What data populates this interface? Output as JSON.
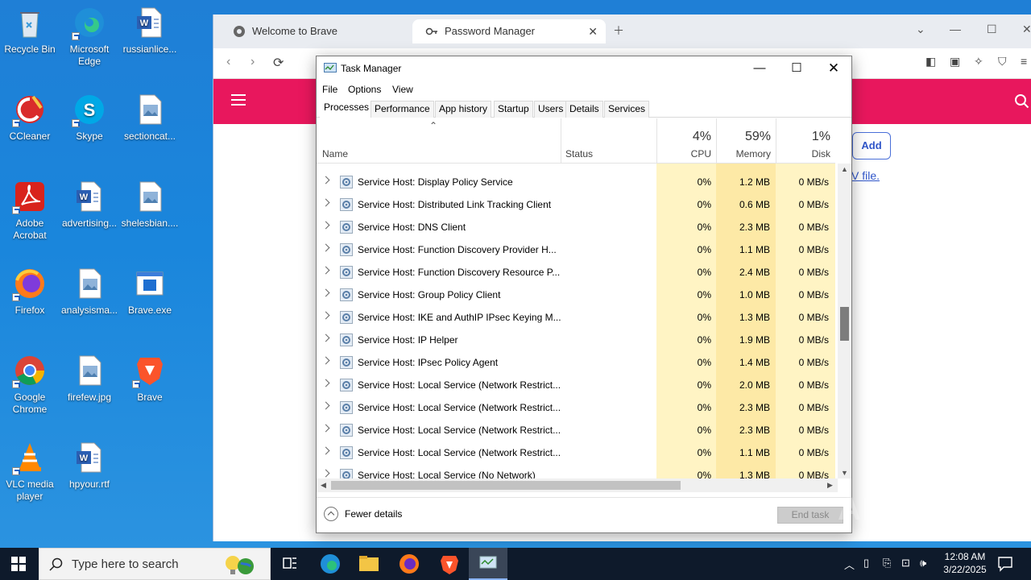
{
  "desktop": {
    "icons": [
      {
        "label": "Recycle Bin",
        "icon": "recycle-bin-icon"
      },
      {
        "label": "Microsoft Edge",
        "icon": "edge-icon"
      },
      {
        "label": "russianlice...",
        "icon": "word-doc-icon"
      },
      {
        "label": "CCleaner",
        "icon": "ccleaner-icon"
      },
      {
        "label": "Skype",
        "icon": "skype-icon"
      },
      {
        "label": "sectioncat...",
        "icon": "image-file-icon"
      },
      {
        "label": "Adobe Acrobat",
        "icon": "acrobat-icon"
      },
      {
        "label": "advertising...",
        "icon": "word-doc-icon"
      },
      {
        "label": "shelesbian....",
        "icon": "image-file-icon"
      },
      {
        "label": "Firefox",
        "icon": "firefox-icon"
      },
      {
        "label": "analysisma...",
        "icon": "image-file-icon"
      },
      {
        "label": "Brave.exe",
        "icon": "exe-file-icon"
      },
      {
        "label": "Google Chrome",
        "icon": "chrome-icon"
      },
      {
        "label": "firefew.jpg",
        "icon": "image-file-icon"
      },
      {
        "label": "Brave",
        "icon": "brave-icon"
      },
      {
        "label": "VLC media player",
        "icon": "vlc-icon"
      },
      {
        "label": "hpyour.rtf",
        "icon": "word-doc-icon"
      }
    ]
  },
  "browser": {
    "tabs": [
      {
        "label": "Welcome to Brave"
      },
      {
        "label": "Password Manager"
      }
    ],
    "add_button": "Add",
    "file_link": "V file."
  },
  "taskmanager": {
    "title": "Task Manager",
    "menu": [
      "File",
      "Options",
      "View"
    ],
    "tabs": [
      "Processes",
      "Performance",
      "App history",
      "Startup",
      "Users",
      "Details",
      "Services"
    ],
    "active_tab": "Processes",
    "columns": {
      "name": "Name",
      "status": "Status",
      "cpu": {
        "pct": "4%",
        "label": "CPU"
      },
      "memory": {
        "pct": "59%",
        "label": "Memory"
      },
      "disk": {
        "pct": "1%",
        "label": "Disk"
      }
    },
    "rows": [
      {
        "name": "Service Host: Display Policy Service",
        "cpu": "0%",
        "memory": "1.2 MB",
        "disk": "0 MB/s"
      },
      {
        "name": "Service Host: Distributed Link Tracking Client",
        "cpu": "0%",
        "memory": "0.6 MB",
        "disk": "0 MB/s"
      },
      {
        "name": "Service Host: DNS Client",
        "cpu": "0%",
        "memory": "2.3 MB",
        "disk": "0 MB/s"
      },
      {
        "name": "Service Host: Function Discovery Provider H...",
        "cpu": "0%",
        "memory": "1.1 MB",
        "disk": "0 MB/s"
      },
      {
        "name": "Service Host: Function Discovery Resource P...",
        "cpu": "0%",
        "memory": "2.4 MB",
        "disk": "0 MB/s"
      },
      {
        "name": "Service Host: Group Policy Client",
        "cpu": "0%",
        "memory": "1.0 MB",
        "disk": "0 MB/s"
      },
      {
        "name": "Service Host: IKE and AuthIP IPsec Keying M...",
        "cpu": "0%",
        "memory": "1.3 MB",
        "disk": "0 MB/s"
      },
      {
        "name": "Service Host: IP Helper",
        "cpu": "0%",
        "memory": "1.9 MB",
        "disk": "0 MB/s"
      },
      {
        "name": "Service Host: IPsec Policy Agent",
        "cpu": "0%",
        "memory": "1.4 MB",
        "disk": "0 MB/s"
      },
      {
        "name": "Service Host: Local Service (Network Restrict...",
        "cpu": "0%",
        "memory": "2.0 MB",
        "disk": "0 MB/s"
      },
      {
        "name": "Service Host: Local Service (Network Restrict...",
        "cpu": "0%",
        "memory": "2.3 MB",
        "disk": "0 MB/s"
      },
      {
        "name": "Service Host: Local Service (Network Restrict...",
        "cpu": "0%",
        "memory": "2.3 MB",
        "disk": "0 MB/s"
      },
      {
        "name": "Service Host: Local Service (Network Restrict...",
        "cpu": "0%",
        "memory": "1.1 MB",
        "disk": "0 MB/s"
      },
      {
        "name": "Service Host: Local Service (No Network)",
        "cpu": "0%",
        "memory": "1.3 MB",
        "disk": "0 MB/s"
      }
    ],
    "fewer_details": "Fewer details",
    "end_task": "End task"
  },
  "watermark": "ANY RUN",
  "taskbar": {
    "search_placeholder": "Type here to search",
    "time": "12:08 AM",
    "date": "3/22/2025"
  }
}
